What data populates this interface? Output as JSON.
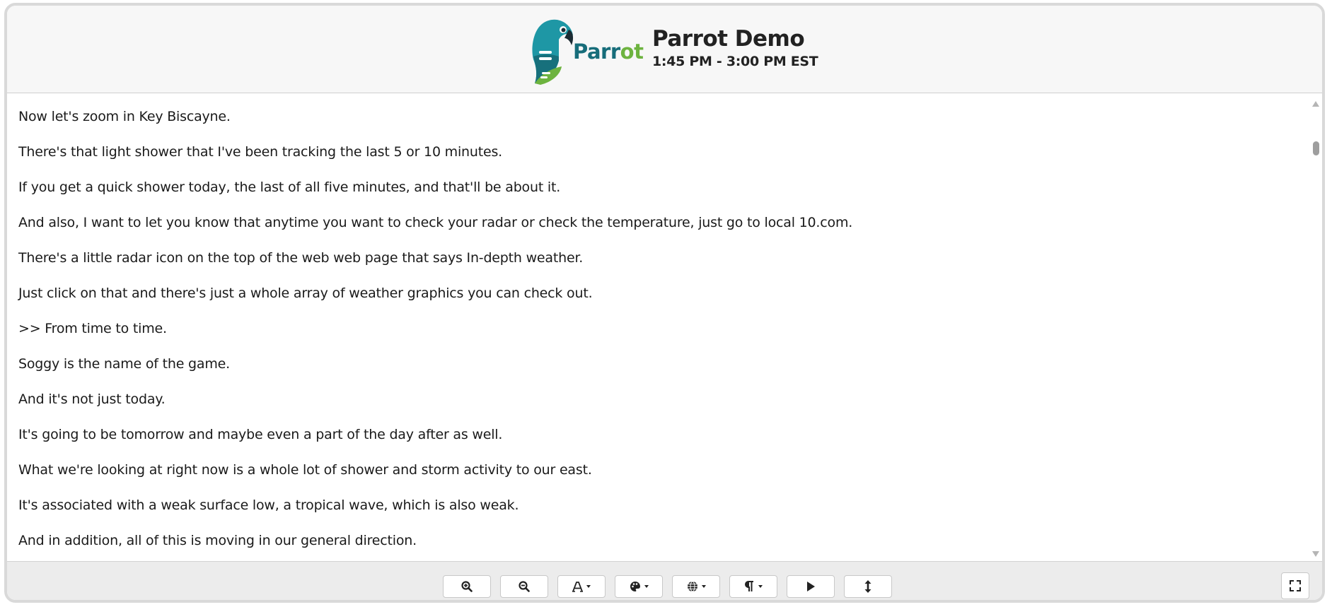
{
  "header": {
    "logo_text_part1": "Parr",
    "logo_text_part2": "ot",
    "title": "Parrot Demo",
    "subtitle": "1:45 PM - 3:00 PM EST"
  },
  "transcript": {
    "lines": [
      "Now let's zoom in Key Biscayne.",
      "There's that light shower that I've been tracking the last 5 or 10 minutes.",
      "If you get a quick shower today, the last of all five minutes, and that'll be about it.",
      "And also, I want to let you know that anytime you want to check your radar or check the temperature, just go to local 10.com.",
      "There's a little radar icon on the top of the web web page that says In-depth weather.",
      "Just click on that and there's just a whole array of weather graphics you can check out.",
      ">> From time to time.",
      "Soggy is the name of the game.",
      "And it's not just today.",
      "It's going to be tomorrow and maybe even a part of the day after as well.",
      "What we're looking at right now is a whole lot of shower and storm activity to our east.",
      "It's associated with a weak surface low, a tropical wave, which is also weak.",
      "And in addition, all of this is moving in our general direction."
    ]
  },
  "toolbar": {
    "buttons": [
      {
        "icon": "zoom-in-icon"
      },
      {
        "icon": "zoom-out-icon"
      },
      {
        "icon": "font-icon"
      },
      {
        "icon": "palette-icon"
      },
      {
        "icon": "globe-icon"
      },
      {
        "icon": "paragraph-icon"
      },
      {
        "icon": "play-icon"
      },
      {
        "icon": "vertical-resize-icon"
      }
    ],
    "fullscreen_icon": "expand-icon"
  },
  "colors": {
    "logo_teal": "#176d7a",
    "logo_green": "#6db33f",
    "header_bg": "#f7f7f7",
    "toolbar_bg": "#ececec",
    "text": "#1a1a1a"
  }
}
